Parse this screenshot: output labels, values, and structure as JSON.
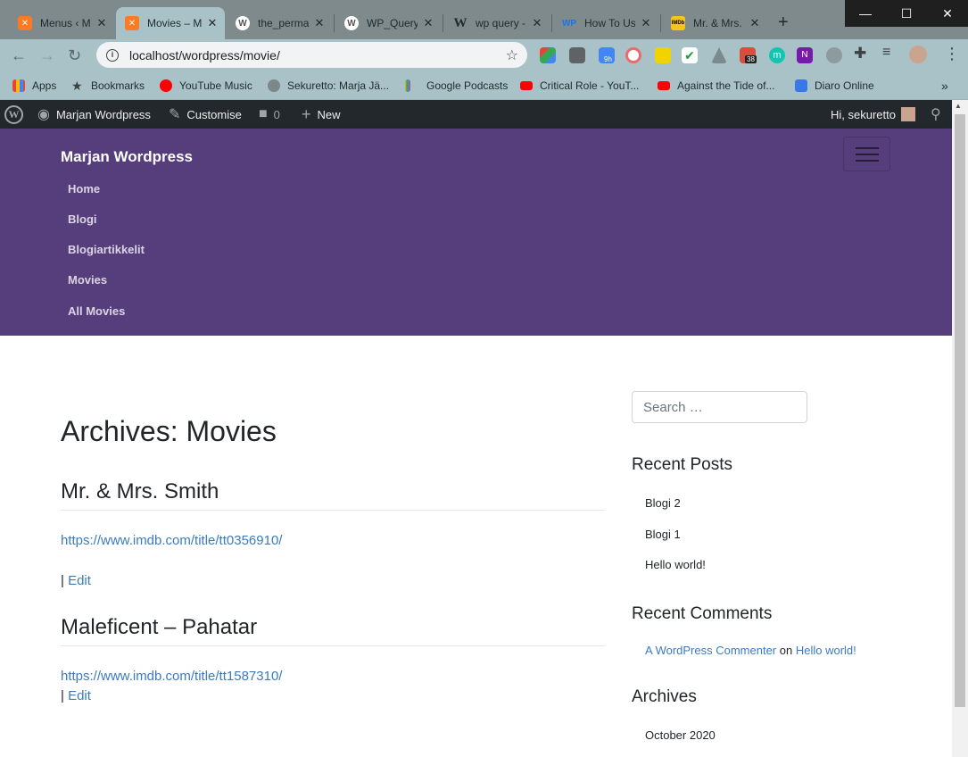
{
  "browser": {
    "tabs": [
      {
        "title": "Menus ‹ M",
        "favicon": "xampp-icon",
        "color": "#fb7a24",
        "active": false
      },
      {
        "title": "Movies – M",
        "favicon": "xampp-icon",
        "color": "#fb7a24",
        "active": true
      },
      {
        "title": "the_perma",
        "favicon": "wordpress-icon",
        "color": "#ffffff",
        "active": false
      },
      {
        "title": "WP_Query",
        "favicon": "wordpress-icon",
        "color": "#ffffff",
        "active": false
      },
      {
        "title": "wp query -",
        "favicon": "wikipedia-icon",
        "color": "#ffffff",
        "active": false
      },
      {
        "title": "How To Us",
        "favicon": "wpbeginner-icon",
        "color": "#1a73e8",
        "active": false
      },
      {
        "title": "Mr. & Mrs.",
        "favicon": "imdb-icon",
        "color": "#f5c518",
        "active": false
      }
    ],
    "url": "localhost/wordpress/movie/",
    "extension_badges": {
      "calendar": "9h",
      "todoist": "38"
    },
    "bookmarks": [
      {
        "label": "Apps",
        "icon": "apps-grid-icon"
      },
      {
        "label": "Bookmarks",
        "icon": "star-icon"
      },
      {
        "label": "YouTube Music",
        "icon": "youtube-music-icon"
      },
      {
        "label": "Sekuretto: Marja Jä...",
        "icon": "globe-icon"
      },
      {
        "label": "Google Podcasts",
        "icon": "google-podcasts-icon"
      },
      {
        "label": "Critical Role - YouT...",
        "icon": "youtube-icon"
      },
      {
        "label": "Against the Tide of...",
        "icon": "youtube-icon"
      },
      {
        "label": "Diaro Online",
        "icon": "diaro-icon"
      }
    ]
  },
  "adminbar": {
    "site_name": "Marjan Wordpress",
    "customise": "Customise",
    "comments_count": "0",
    "new_label": "New",
    "greeting": "Hi, sekuretto"
  },
  "site": {
    "brand": "Marjan Wordpress",
    "nav": [
      "Home",
      "Blogi",
      "Blogiartikkelit",
      "Movies",
      "All Movies"
    ]
  },
  "main": {
    "archive_title": "Archives: Movies",
    "posts": [
      {
        "title": "Mr. & Mrs. Smith",
        "link": "https://www.imdb.com/title/tt0356910/",
        "sep": "|",
        "edit": "Edit"
      },
      {
        "title": "Maleficent – Pahatar",
        "link": "https://www.imdb.com/title/tt1587310/",
        "sep": "|",
        "edit": "Edit"
      }
    ]
  },
  "sidebar": {
    "search_placeholder": "Search …",
    "recent_posts_title": "Recent Posts",
    "recent_posts": [
      "Blogi 2",
      "Blogi 1",
      "Hello world!"
    ],
    "recent_comments_title": "Recent Comments",
    "recent_comment": {
      "author": "A WordPress Commenter",
      "on": "on",
      "post": "Hello world!"
    },
    "archives_title": "Archives",
    "archives": [
      "October 2020"
    ]
  }
}
